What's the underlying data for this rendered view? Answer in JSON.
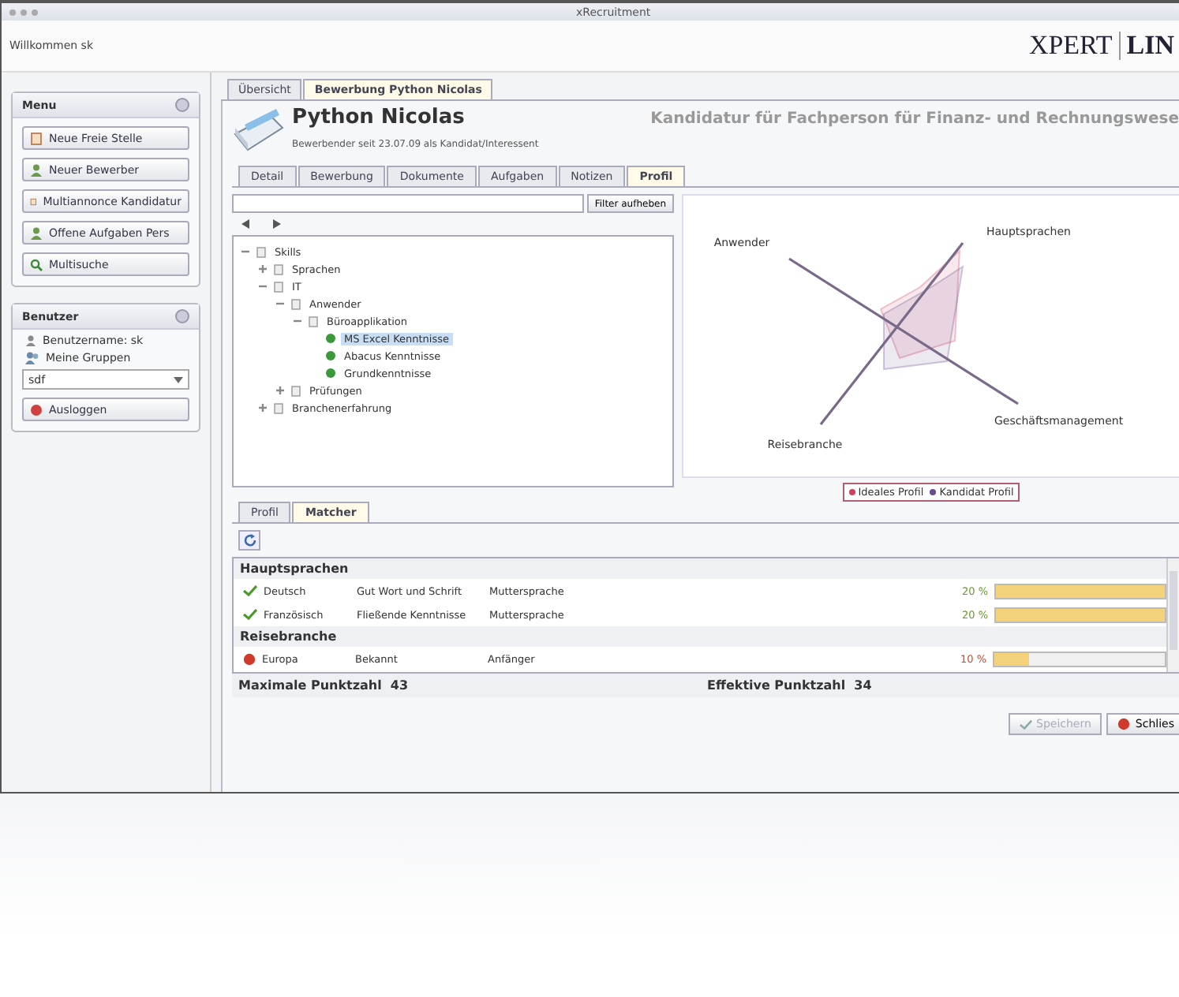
{
  "window": {
    "title": "xRecruitment"
  },
  "header": {
    "welcome": "Willkommen sk",
    "logo_left": "XPERT",
    "logo_right": "LIN"
  },
  "menu_panel": {
    "title": "Menu",
    "items": [
      {
        "label": "Neue Freie Stelle"
      },
      {
        "label": "Neuer Bewerber"
      },
      {
        "label": "Multiannonce Kandidatur"
      },
      {
        "label": "Offene Aufgaben Pers"
      },
      {
        "label": "Multisuche"
      }
    ]
  },
  "user_panel": {
    "title": "Benutzer",
    "username": "Benutzername: sk",
    "groups": "Meine Gruppen",
    "group_value": "sdf",
    "logout": "Ausloggen"
  },
  "top_tabs": [
    {
      "label": "Übersicht",
      "selected": false
    },
    {
      "label": "Bewerbung Python Nicolas",
      "selected": true
    }
  ],
  "candidate": {
    "name": "Python Nicolas",
    "subtitle": "Bewerbender seit 23.07.09 als Kandidat/Interessent",
    "position": "Kandidatur für Fachperson für Finanz- und Rechnungswese"
  },
  "sub_tabs": [
    {
      "label": "Detail",
      "selected": false
    },
    {
      "label": "Bewerbung",
      "selected": false
    },
    {
      "label": "Dokumente",
      "selected": false
    },
    {
      "label": "Aufgaben",
      "selected": false
    },
    {
      "label": "Notizen",
      "selected": false
    },
    {
      "label": "Profil",
      "selected": true
    }
  ],
  "filter": {
    "button": "Filter aufheben"
  },
  "tree": [
    {
      "kind": "branch",
      "label": "Skills",
      "expanded": true,
      "selected": false,
      "children": [
        {
          "kind": "branch",
          "label": "Sprachen",
          "expanded": false,
          "selected": false
        },
        {
          "kind": "branch",
          "label": "IT",
          "expanded": true,
          "selected": false,
          "children": [
            {
              "kind": "branch",
              "label": "Anwender",
              "expanded": true,
              "selected": false,
              "children": [
                {
                  "kind": "branch",
                  "label": "Büroapplikation",
                  "expanded": true,
                  "selected": false,
                  "children": [
                    {
                      "kind": "leaf",
                      "label": "MS Excel Kenntnisse",
                      "selected": true
                    },
                    {
                      "kind": "leaf",
                      "label": "Abacus Kenntnisse",
                      "selected": false
                    },
                    {
                      "kind": "leaf",
                      "label": "Grundkenntnisse",
                      "selected": false
                    }
                  ]
                }
              ]
            },
            {
              "kind": "branch",
              "label": "Prüfungen",
              "expanded": false,
              "selected": false
            }
          ]
        },
        {
          "kind": "branch",
          "label": "Branchenerfahrung",
          "expanded": false,
          "selected": false
        }
      ]
    }
  ],
  "radar": {
    "axes": [
      "Hauptsprachen",
      "Geschäftsmanagement",
      "Reisebranche",
      "Anwender"
    ],
    "legend": [
      {
        "label": "Ideales Profil",
        "color": "#d04060"
      },
      {
        "label": "Kandidat Profil",
        "color": "#6a4a8a"
      }
    ]
  },
  "bottom_tabs": [
    {
      "label": "Profil",
      "selected": false
    },
    {
      "label": "Matcher",
      "selected": true
    }
  ],
  "matcher": {
    "groups": [
      {
        "title": "Hauptsprachen",
        "rows": [
          {
            "matched": true,
            "cells": [
              "Deutsch",
              "Gut Wort und Schrift",
              "Muttersprache"
            ],
            "score": "20 %",
            "level": 1.0
          },
          {
            "matched": true,
            "cells": [
              "Französisch",
              "Fließende Kenntnisse",
              "Muttersprache"
            ],
            "score": "20 %",
            "level": 1.0
          }
        ]
      },
      {
        "title": "Reisebranche",
        "rows": [
          {
            "matched": false,
            "cells": [
              "Europa",
              "Bekannt",
              "Anfänger"
            ],
            "score": "10 %",
            "level": 0.2
          }
        ]
      }
    ],
    "max_label": "Maximale Punktzahl",
    "max_value": "43",
    "eff_label": "Effektive Punktzahl",
    "eff_value": "34"
  },
  "buttons": [
    {
      "label": "Speichern",
      "disabled": true
    },
    {
      "label": "Schlies",
      "disabled": false
    }
  ]
}
